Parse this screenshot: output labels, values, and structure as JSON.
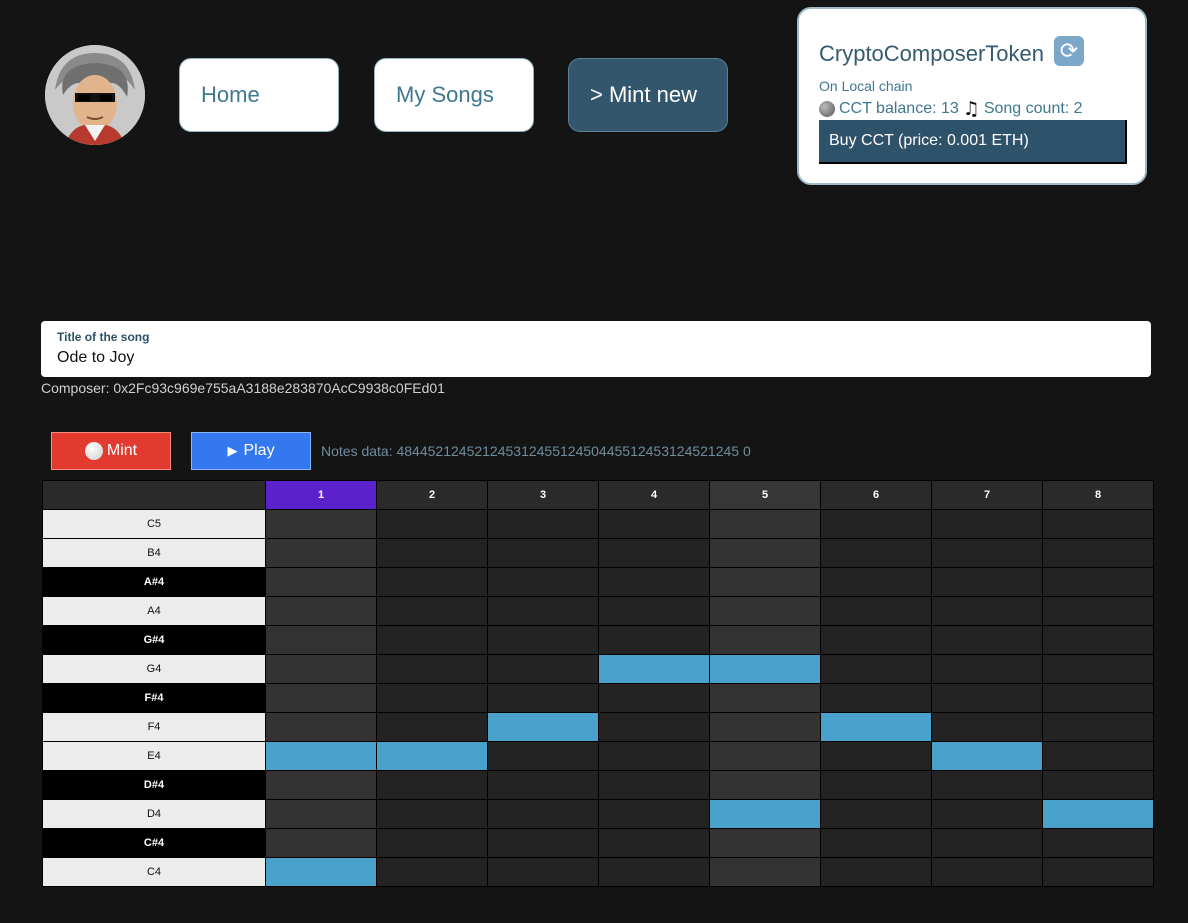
{
  "nav": {
    "home_label": "Home",
    "my_songs_label": "My Songs",
    "mint_new_label": "> Mint new"
  },
  "token": {
    "title": "CryptoComposerToken",
    "chain": "On Local chain",
    "balance_text": "CCT balance: 13",
    "song_count_text": "Song count: 2",
    "buy_label": "Buy CCT (price: 0.001 ETH)",
    "refresh_icon": "refresh-icon",
    "coin_icon": "coin-icon",
    "note_icon": "musical-notes-icon"
  },
  "song": {
    "title_label": "Title of the song",
    "title_value": "Ode to Joy",
    "composer": "Composer: 0x2Fc93c969e755aA3188e283870AcC9938c0FEd01"
  },
  "controls": {
    "mint_label": "Mint",
    "play_label": "Play",
    "notes_data": "Notes data: 48445212452124531245512450445512453124521245 0"
  },
  "grid": {
    "columns": [
      "1",
      "2",
      "3",
      "4",
      "5",
      "6",
      "7",
      "8"
    ],
    "active_column": 0,
    "notes": [
      {
        "name": "C5",
        "black": false
      },
      {
        "name": "B4",
        "black": false
      },
      {
        "name": "A#4",
        "black": true
      },
      {
        "name": "A4",
        "black": false
      },
      {
        "name": "G#4",
        "black": true
      },
      {
        "name": "G4",
        "black": false
      },
      {
        "name": "F#4",
        "black": true
      },
      {
        "name": "F4",
        "black": false
      },
      {
        "name": "E4",
        "black": false
      },
      {
        "name": "D#4",
        "black": true
      },
      {
        "name": "D4",
        "black": false
      },
      {
        "name": "C#4",
        "black": true
      },
      {
        "name": "C4",
        "black": false
      }
    ],
    "active_steps": [
      {
        "note": "G4",
        "steps": [
          4,
          5
        ]
      },
      {
        "note": "F4",
        "steps": [
          3,
          6
        ]
      },
      {
        "note": "E4",
        "steps": [
          1,
          2,
          7
        ]
      },
      {
        "note": "D4",
        "steps": [
          5,
          8
        ]
      },
      {
        "note": "C4",
        "steps": [
          1
        ]
      }
    ]
  },
  "colors": {
    "background": "#141414",
    "accent_dark": "#33566d",
    "step_on": "#4aa2cc",
    "active_column": "#5b22cc",
    "mint_button": "#e23a2e",
    "play_button": "#3478f0"
  }
}
